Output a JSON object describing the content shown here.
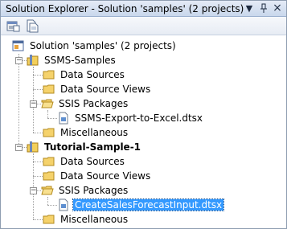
{
  "titlebar": {
    "title": "Solution Explorer - Solution 'samples' (2 projects)",
    "dropdown_glyph": "▼",
    "pin_glyph": "ᛘ",
    "close_glyph": "×"
  },
  "toolbar": {
    "buttons": [
      "properties-icon",
      "show-all-files-icon"
    ]
  },
  "tree": {
    "solution": "Solution 'samples' (2 projects)",
    "projects": [
      {
        "name": "SSMS-Samples",
        "folders": [
          "Data Sources",
          "Data Source Views",
          "SSIS Packages",
          "Miscellaneous"
        ],
        "package": "SSMS-Export-to-Excel.dtsx"
      },
      {
        "name": "Tutorial-Sample-1",
        "folders": [
          "Data Sources",
          "Data Source Views",
          "SSIS Packages",
          "Miscellaneous"
        ],
        "package": "CreateSalesForecastInput.dtsx"
      }
    ],
    "selected": "CreateSalesForecastInput.dtsx"
  },
  "colors": {
    "selection": "#3399ff",
    "title_gradient_top": "#e4ebf6",
    "title_gradient_bottom": "#c9d7ec"
  }
}
